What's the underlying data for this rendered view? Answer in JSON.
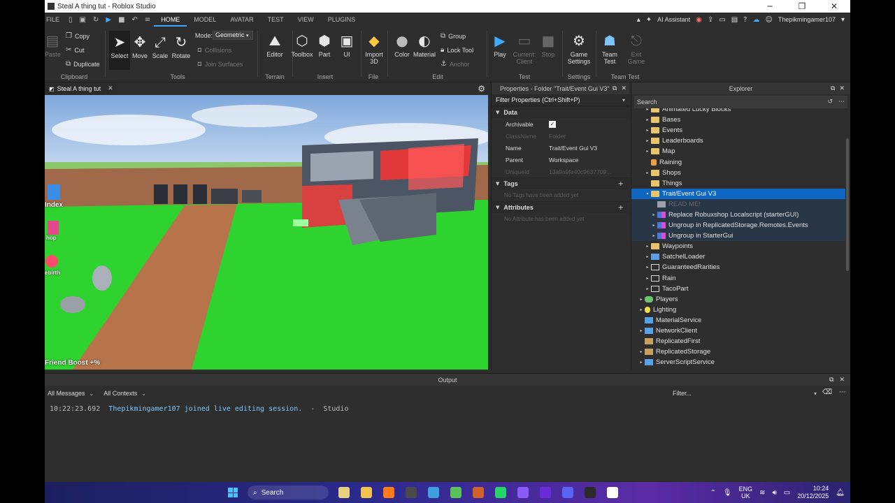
{
  "window": {
    "title": "Steal A thing tut - Roblox Studio",
    "minimize": "─",
    "maximize": "❐",
    "close": "✕"
  },
  "menu": {
    "file": "FILE",
    "tabs": [
      "HOME",
      "MODEL",
      "AVATAR",
      "TEST",
      "VIEW",
      "PLUGINS"
    ],
    "active_tab": "HOME",
    "ai_assistant": "AI Assistant",
    "username": "Thepikmingamer107"
  },
  "ribbon": {
    "clipboard": {
      "label": "Clipboard",
      "paste": "Paste",
      "copy": "Copy",
      "cut": "Cut",
      "duplicate": "Duplicate"
    },
    "tools": {
      "label": "Tools",
      "select": "Select",
      "move": "Move",
      "scale": "Scale",
      "rotate": "Rotate",
      "mode_label": "Mode:",
      "mode_value": "Geometric",
      "collisions": "Collisions",
      "join_surfaces": "Join Surfaces"
    },
    "terrain": {
      "label": "Terrain",
      "editor": "Editor"
    },
    "insert": {
      "label": "Insert",
      "toolbox": "Toolbox",
      "part": "Part",
      "ui": "UI"
    },
    "file": {
      "label": "File",
      "import": "Import 3D"
    },
    "edit": {
      "label": "Edit",
      "color": "Color",
      "material": "Material",
      "group": "Group",
      "lock_tool": "Lock Tool",
      "anchor": "Anchor"
    },
    "test": {
      "label": "Test",
      "play": "Play",
      "current_client": "Current: Client",
      "stop": "Stop"
    },
    "settings": {
      "label": "Settings",
      "game_settings": "Game Settings"
    },
    "team_test": {
      "label": "Team Test",
      "team_test": "Team Test",
      "exit_game": "Exit Game"
    }
  },
  "viewport": {
    "tab_title": "Steal A thing tut",
    "side_buttons": [
      "Index",
      "hop",
      "ebirth"
    ],
    "friend_boost": "Friend Boost +%"
  },
  "properties": {
    "title": "Properties - Folder \"Trait/Event Gui V3\"",
    "filter": "Filter Properties (Ctrl+Shift+P)",
    "data_section": "Data",
    "rows": [
      {
        "name": "Archivable",
        "value": "",
        "checkbox": true,
        "dim": false
      },
      {
        "name": "ClassName",
        "value": "Folder",
        "dim": true
      },
      {
        "name": "Name",
        "value": "Trait/Event Gui V3",
        "dim": false
      },
      {
        "name": "Parent",
        "value": "Workspace",
        "dim": false
      },
      {
        "name": "UniqueId",
        "value": "13a9a9fe40c9637709...",
        "dim": true
      }
    ],
    "tags_section": "Tags",
    "tags_empty": "No Tags have been added yet",
    "attributes_section": "Attributes",
    "attributes_empty": "No Attribute has been added yet"
  },
  "explorer": {
    "title": "Explorer",
    "search_placeholder": "Search",
    "items": [
      {
        "label": "Animated Lucky Blocks",
        "indent": 2,
        "icon": "folder",
        "arrow": "▸",
        "state": "partial"
      },
      {
        "label": "Bases",
        "indent": 2,
        "icon": "folder",
        "arrow": "▸"
      },
      {
        "label": "Events",
        "indent": 2,
        "icon": "folder",
        "arrow": "▸"
      },
      {
        "label": "Leaderboards",
        "indent": 2,
        "icon": "folder",
        "arrow": "▸"
      },
      {
        "label": "Map",
        "indent": 2,
        "icon": "folder",
        "arrow": "▸"
      },
      {
        "label": "Raining",
        "indent": 2,
        "icon": "sound",
        "arrow": ""
      },
      {
        "label": "Shops",
        "indent": 2,
        "icon": "folder",
        "arrow": "▸"
      },
      {
        "label": "Things",
        "indent": 2,
        "icon": "folder",
        "arrow": ""
      },
      {
        "label": "Trait/Event Gui V3",
        "indent": 2,
        "icon": "folder",
        "arrow": "▾",
        "state": "selected"
      },
      {
        "label": "READ ME!",
        "indent": 3,
        "icon": "script",
        "arrow": "",
        "state": "sub-dim"
      },
      {
        "label": "Replace Robuxshop Localscript (starterGUI)",
        "indent": 3,
        "icon": "grid",
        "arrow": "▸",
        "state": "sub"
      },
      {
        "label": "Ungroup in ReplicatedStorage.Remotes.Events",
        "indent": 3,
        "icon": "grid",
        "arrow": "▸",
        "state": "sub"
      },
      {
        "label": "Ungroup in StarterGui",
        "indent": 3,
        "icon": "grid",
        "arrow": "▸",
        "state": "sub"
      },
      {
        "label": "Waypoints",
        "indent": 2,
        "icon": "folder",
        "arrow": "▸"
      },
      {
        "label": "SatchelLoader",
        "indent": 2,
        "icon": "blue",
        "arrow": "▸"
      },
      {
        "label": "GuaranteedRarities",
        "indent": 2,
        "icon": "part",
        "arrow": "▸"
      },
      {
        "label": "Rain",
        "indent": 2,
        "icon": "part",
        "arrow": "▸"
      },
      {
        "label": "TacoPart",
        "indent": 2,
        "icon": "part",
        "arrow": "▸"
      },
      {
        "label": "Players",
        "indent": 1,
        "icon": "people",
        "arrow": "▸"
      },
      {
        "label": "Lighting",
        "indent": 1,
        "icon": "bulb",
        "arrow": "▸"
      },
      {
        "label": "MaterialService",
        "indent": 1,
        "icon": "blue",
        "arrow": ""
      },
      {
        "label": "NetworkClient",
        "indent": 1,
        "icon": "blue",
        "arrow": "▸"
      },
      {
        "label": "ReplicatedFirst",
        "indent": 1,
        "icon": "storage",
        "arrow": ""
      },
      {
        "label": "ReplicatedStorage",
        "indent": 1,
        "icon": "storage",
        "arrow": "▸"
      },
      {
        "label": "ServerScriptService",
        "indent": 1,
        "icon": "blue",
        "arrow": "▸"
      }
    ]
  },
  "output": {
    "title": "Output",
    "messages_filter": "All Messages",
    "contexts_filter": "All Contexts",
    "filter_placeholder": "Filter...",
    "line_time": "10:22:23.692",
    "line_user": "Thepikmingamer107 joined live editing session.",
    "line_source": "  -  Studio"
  },
  "taskbar": {
    "search": "Search",
    "lang_top": "ENG",
    "lang_bottom": "UK",
    "time": "10:24",
    "date": "20/12/2025",
    "app_colors": [
      "#e8d080",
      "#f2c14e",
      "#ff7a1a",
      "#4a4a4a",
      "#3fa0e0",
      "#5bc25b",
      "#d0612b",
      "#25d366",
      "#8a5cf6",
      "#6b2bd9",
      "#5865f2",
      "#2b2b2b",
      "#ffffff"
    ]
  }
}
